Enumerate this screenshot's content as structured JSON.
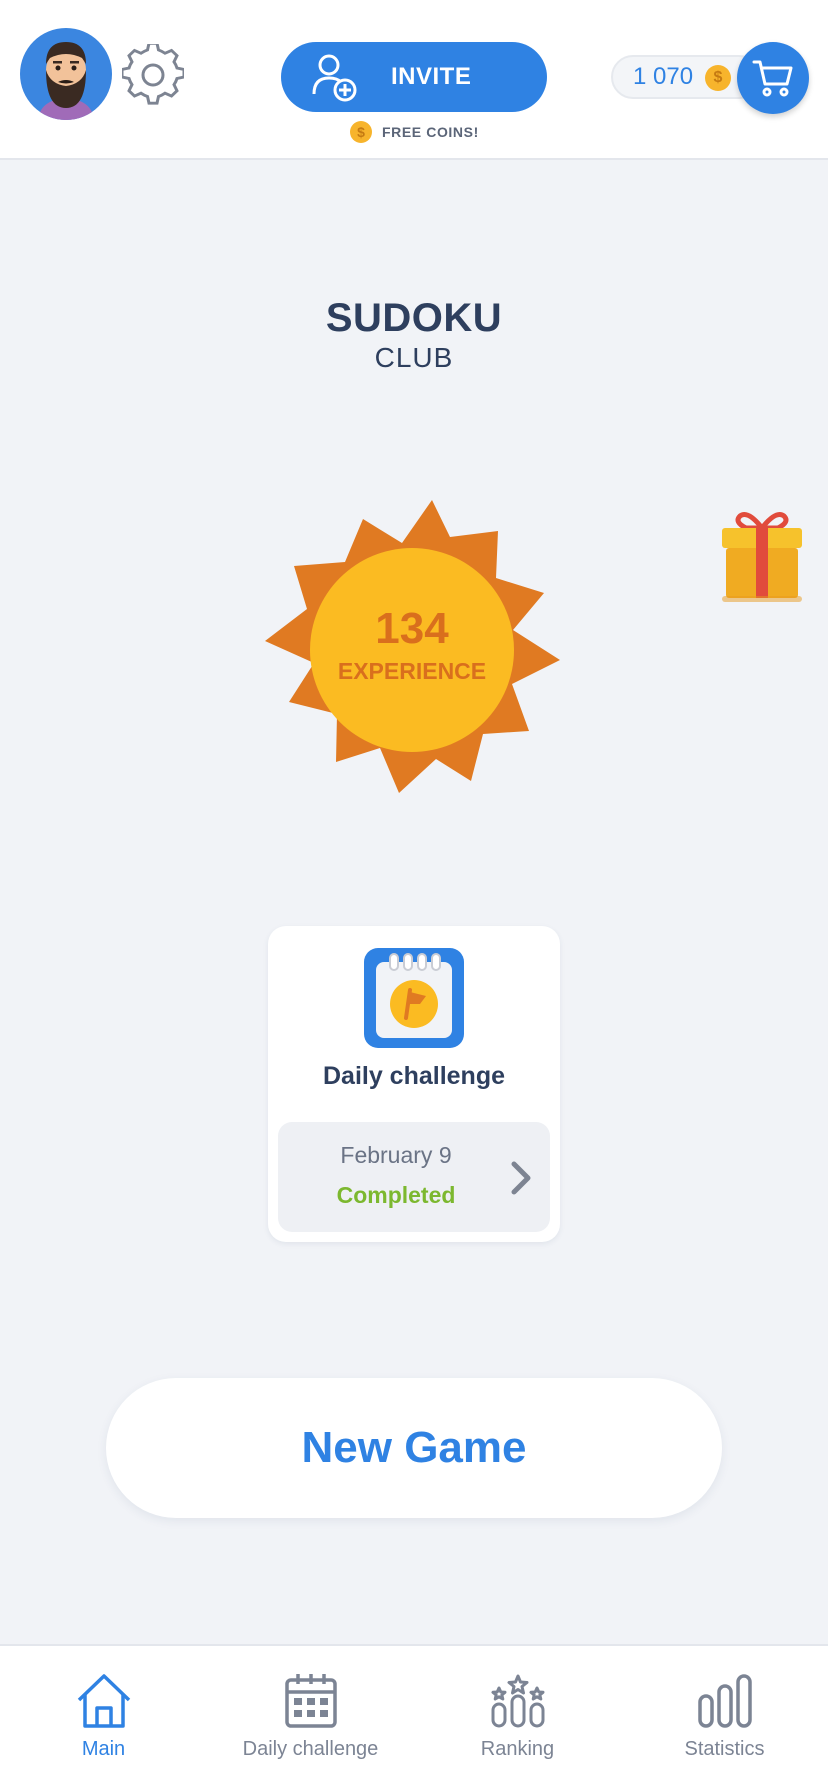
{
  "header": {
    "invite_label": "INVITE",
    "free_coins_label": "FREE COINS!",
    "coin_symbol": "$",
    "coins_balance": "1 070",
    "icons": [
      "avatar",
      "settings-gear-icon",
      "add-user-icon",
      "coin-icon",
      "cart-icon"
    ]
  },
  "main": {
    "title": "SUDOKU",
    "subtitle": "CLUB",
    "experience_value": "134",
    "experience_label": "EXPERIENCE",
    "gift_icon": "gift-icon"
  },
  "daily_card": {
    "title": "Daily challenge",
    "date": "February 9",
    "status": "Completed",
    "icon": "calendar-flag-icon"
  },
  "new_game_label": "New Game",
  "bottom_nav": {
    "items": [
      {
        "label": "Main",
        "icon": "home-icon",
        "active": true
      },
      {
        "label": "Daily challenge",
        "icon": "calendar-icon",
        "active": false
      },
      {
        "label": "Ranking",
        "icon": "ranking-icon",
        "active": false
      },
      {
        "label": "Statistics",
        "icon": "stats-icon",
        "active": false
      }
    ]
  },
  "colors": {
    "accent": "#2f82e3",
    "sun_outer": "#e07a22",
    "sun_inner": "#fbbb22",
    "completed": "#7cb82f",
    "background": "#f1f3f7"
  }
}
